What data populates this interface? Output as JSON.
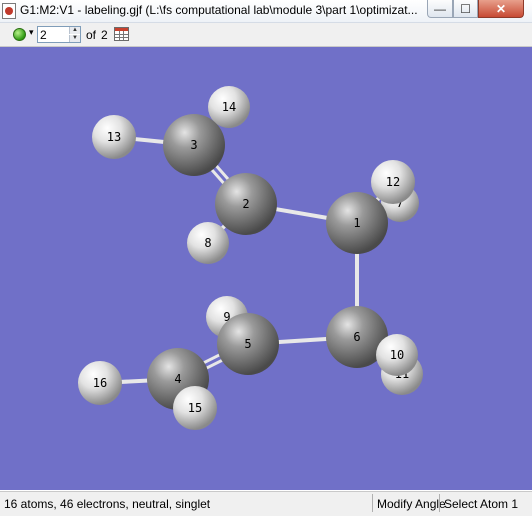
{
  "window": {
    "title": "G1:M2:V1 - labeling.gjf (L:\\fs computational lab\\module 3\\part 1\\optimizat...",
    "min_glyph": "—",
    "max_glyph": "☐",
    "close_glyph": "✕"
  },
  "toolbar": {
    "model_value": "2",
    "of_label": "of",
    "total_models": "2"
  },
  "molecule": {
    "atoms": [
      {
        "label": "1",
        "element": "C"
      },
      {
        "label": "2",
        "element": "C"
      },
      {
        "label": "3",
        "element": "C"
      },
      {
        "label": "4",
        "element": "C"
      },
      {
        "label": "5",
        "element": "C"
      },
      {
        "label": "6",
        "element": "C"
      },
      {
        "label": "7",
        "element": "H"
      },
      {
        "label": "8",
        "element": "H"
      },
      {
        "label": "9",
        "element": "H"
      },
      {
        "label": "10",
        "element": "H"
      },
      {
        "label": "11",
        "element": "H"
      },
      {
        "label": "12",
        "element": "H"
      },
      {
        "label": "13",
        "element": "H"
      },
      {
        "label": "14",
        "element": "H"
      },
      {
        "label": "15",
        "element": "H"
      },
      {
        "label": "16",
        "element": "H"
      }
    ],
    "colors": {
      "background": "#7070c8",
      "carbon": "#7a7a7a",
      "hydrogen": "#d9d9d9",
      "bond": "#e8e8e8"
    }
  },
  "statusbar": {
    "summary": "16 atoms, 46 electrons, neutral, singlet",
    "mode": "Modify Angle",
    "selection": "Select Atom 1"
  }
}
